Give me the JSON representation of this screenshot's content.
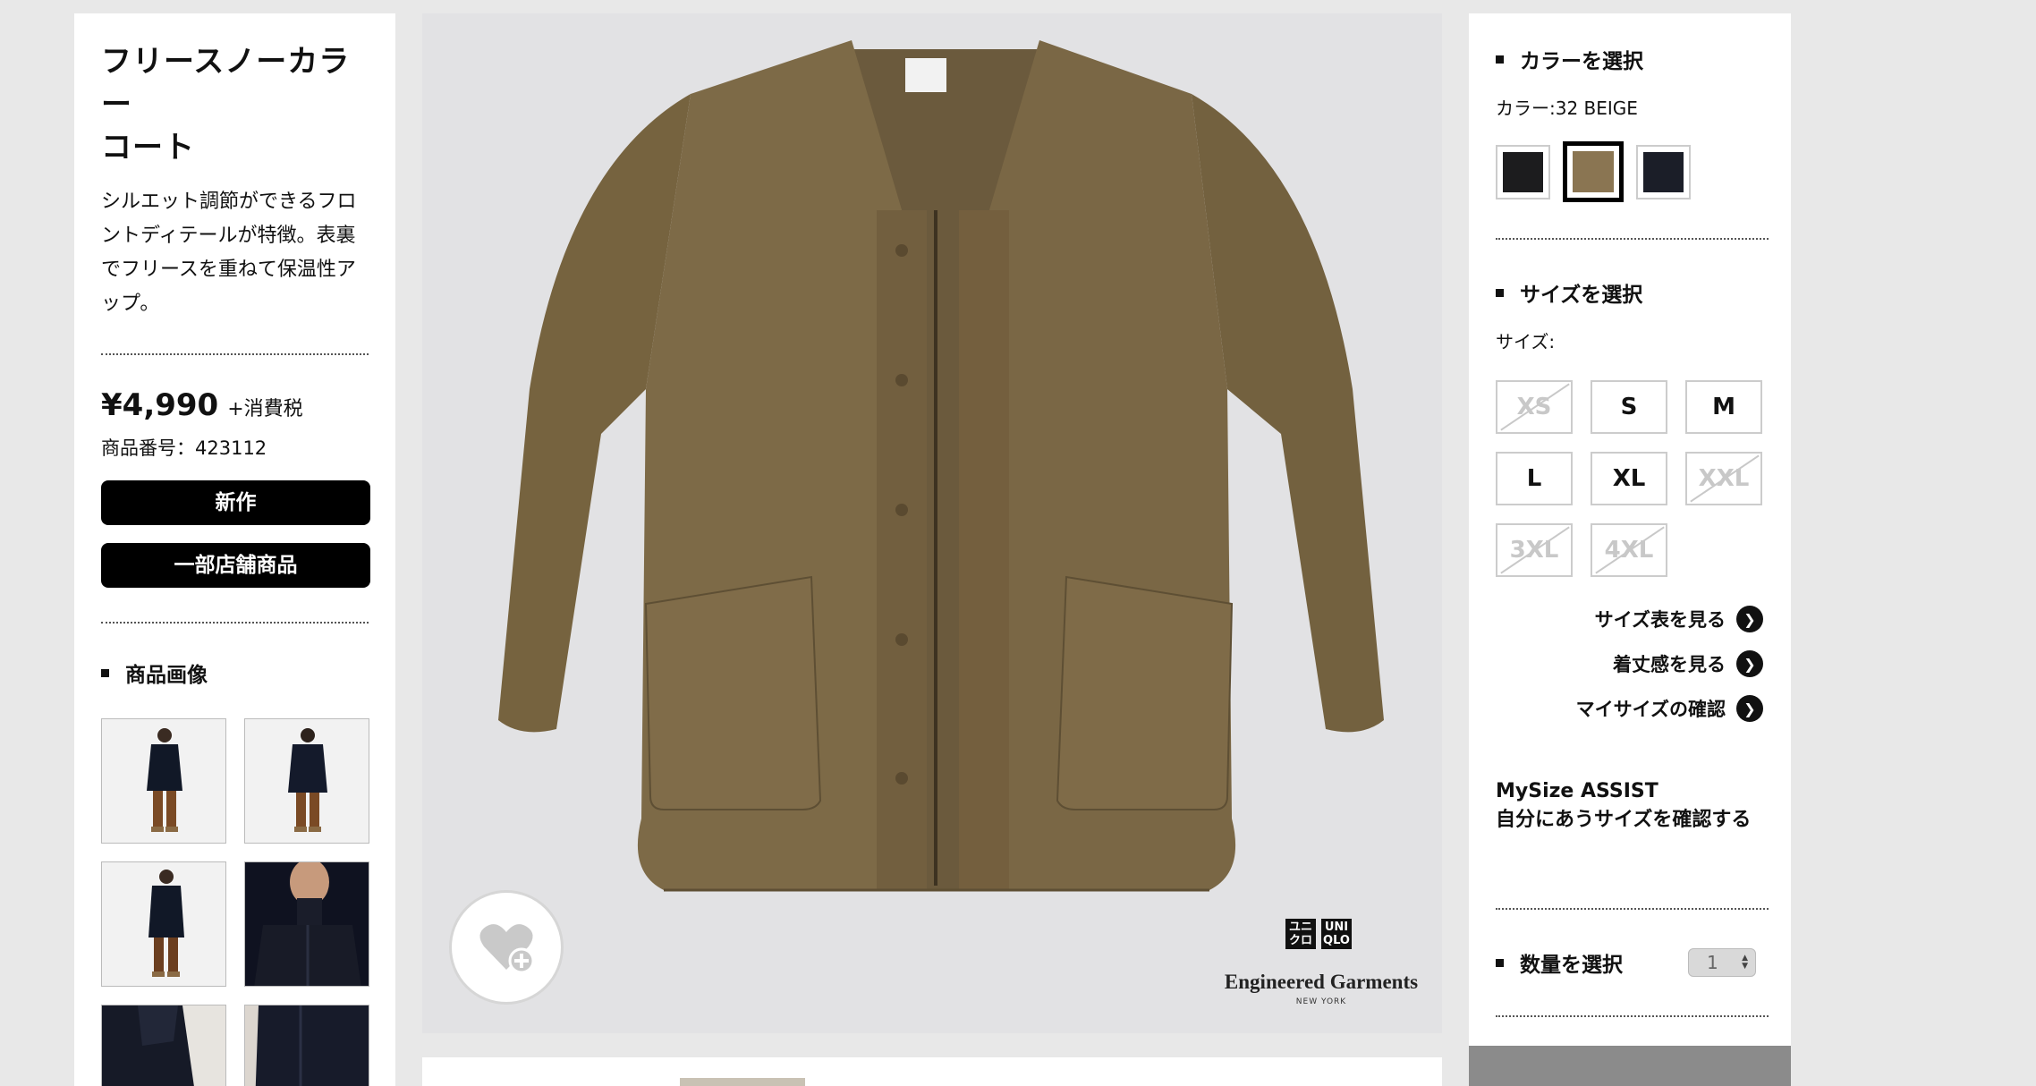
{
  "product": {
    "title_line1": "フリースノーカラー",
    "title_line2": "コート",
    "description": "シルエット調節ができるフロントディテールが特徴。表裏でフリースを重ねて保温性アップ。",
    "price": "¥4,990",
    "tax_note": "+消費税",
    "sku": "商品番号：423112",
    "badges": [
      "新作",
      "一部店舗商品"
    ],
    "images_heading": "商品画像"
  },
  "hero": {
    "brand_logo_left": "ユニ\nクロ",
    "brand_logo_right": "UNI\nQLO",
    "collab_name": "Engineered Garments",
    "collab_city": "NEW YORK"
  },
  "color": {
    "heading": "カラーを選択",
    "current": "カラー:32 BEIGE",
    "swatches": [
      {
        "name": "black",
        "color": "#1c1c1e",
        "selected": false
      },
      {
        "name": "beige",
        "color": "#8a7552",
        "selected": true
      },
      {
        "name": "navy",
        "color": "#1b1e28",
        "selected": false
      }
    ]
  },
  "size": {
    "heading": "サイズを選択",
    "label": "サイズ:",
    "options": [
      {
        "label": "XS",
        "available": false
      },
      {
        "label": "S",
        "available": true
      },
      {
        "label": "M",
        "available": true
      },
      {
        "label": "L",
        "available": true
      },
      {
        "label": "XL",
        "available": true
      },
      {
        "label": "XXL",
        "available": false
      },
      {
        "label": "3XL",
        "available": false
      },
      {
        "label": "4XL",
        "available": false
      }
    ],
    "links": [
      "サイズ表を見る",
      "着丈感を見る",
      "マイサイズの確認"
    ]
  },
  "assist": {
    "line1": "MySize ASSIST",
    "line2": "自分にあうサイズを確認する"
  },
  "quantity": {
    "heading": "数量を選択",
    "value": "1"
  },
  "colors": {
    "coat": "#7d6a47",
    "coat_dark": "#5e4f34",
    "background": "#e8e8e8"
  }
}
